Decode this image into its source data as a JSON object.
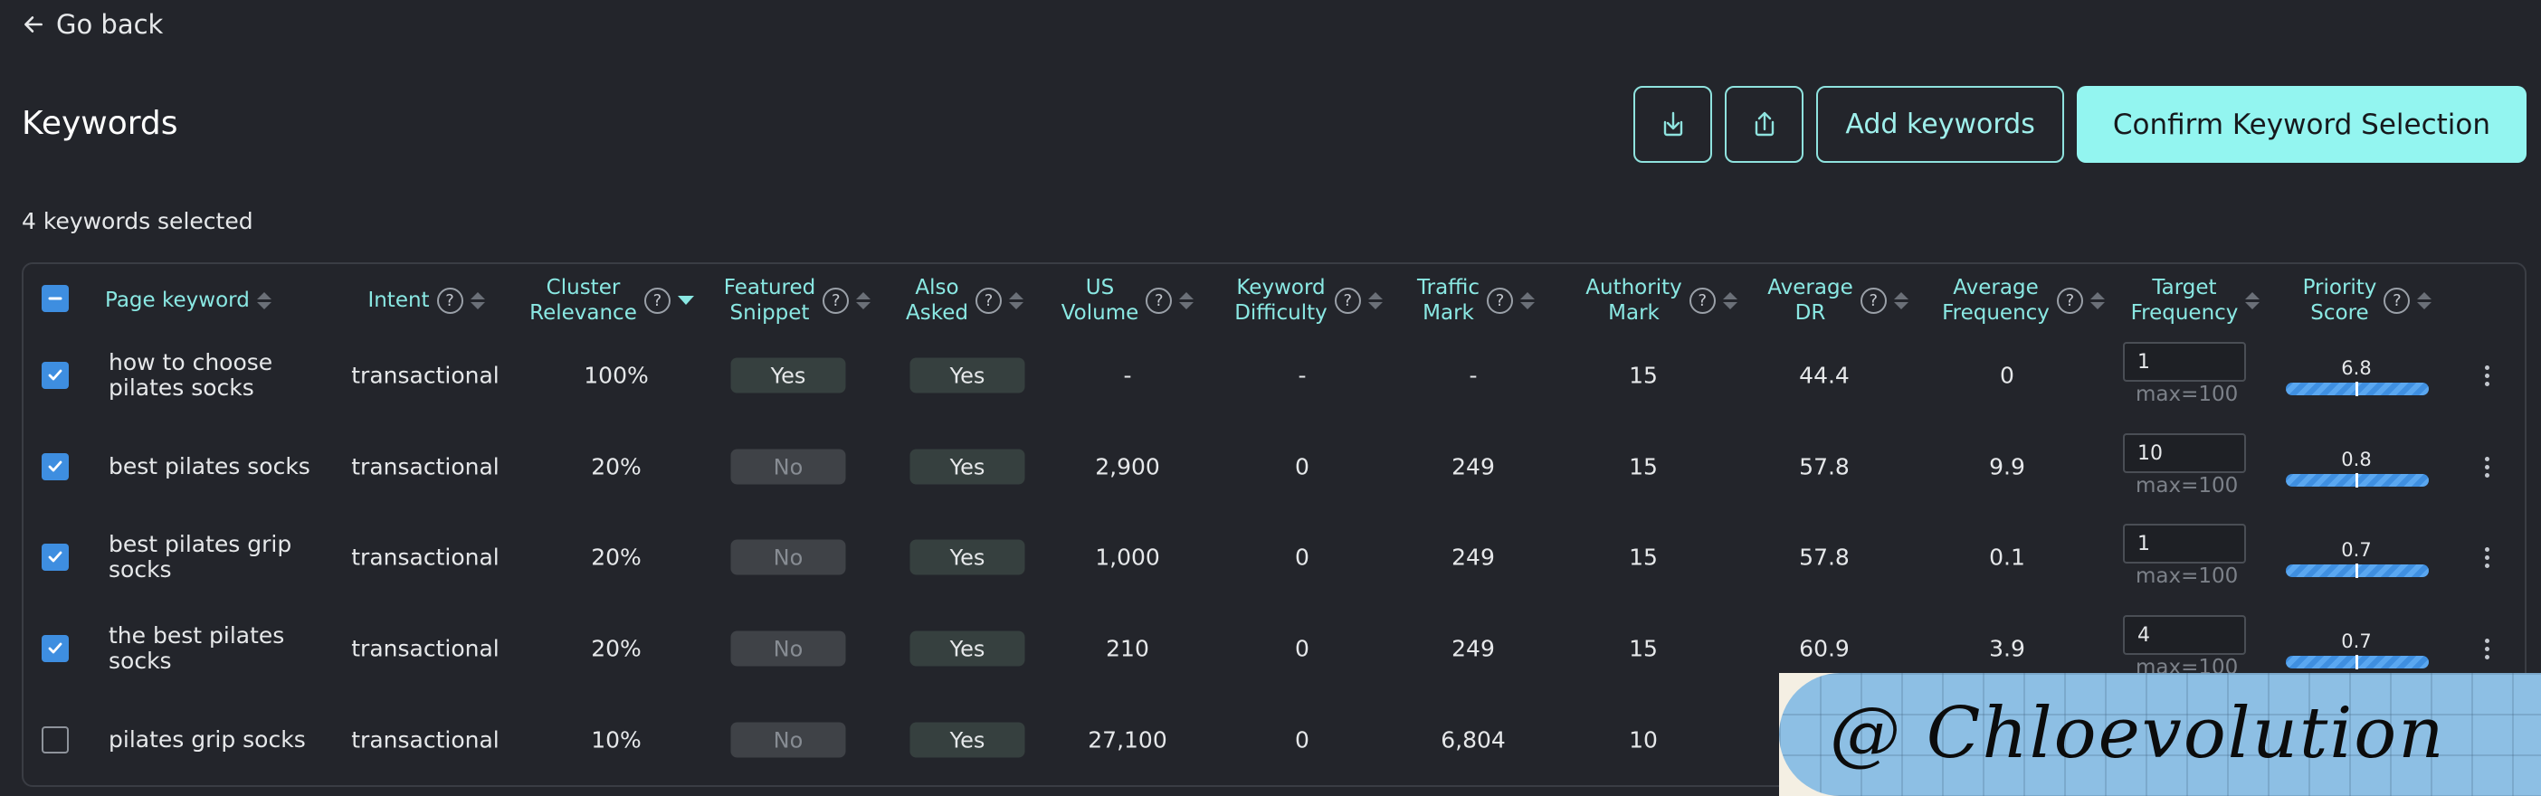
{
  "nav": {
    "go_back": "Go back"
  },
  "page": {
    "title": "Keywords",
    "selected_text": "4 keywords selected"
  },
  "toolbar": {
    "add_keywords": "Add keywords",
    "confirm": "Confirm Keyword Selection"
  },
  "columns": {
    "page_keyword": "Page keyword",
    "intent": "Intent",
    "cluster_relevance": [
      "Cluster",
      "Relevance"
    ],
    "featured_snippet": [
      "Featured",
      "Snippet"
    ],
    "also_asked": [
      "Also",
      "Asked"
    ],
    "us_volume": [
      "US",
      "Volume"
    ],
    "keyword_difficulty": [
      "Keyword",
      "Difficulty"
    ],
    "traffic_mark": [
      "Traffic",
      "Mark"
    ],
    "authority_mark": [
      "Authority",
      "Mark"
    ],
    "average_dr": [
      "Average",
      "DR"
    ],
    "average_frequency": [
      "Average",
      "Frequency"
    ],
    "target_frequency": [
      "Target",
      "Frequency"
    ],
    "priority_score": [
      "Priority",
      "Score"
    ]
  },
  "help_glyph": "?",
  "rows": [
    {
      "keyword": "how to choose pilates socks",
      "checked": true,
      "intent": "transactional",
      "relevance": "100%",
      "featured": "Yes",
      "also_asked": "Yes",
      "volume": "-",
      "difficulty": "-",
      "traffic": "-",
      "authority": "15",
      "avg_dr": "44.4",
      "avg_freq": "0",
      "target_freq": "1",
      "max": "max=100",
      "priority": "6.8"
    },
    {
      "keyword": "best pilates socks",
      "checked": true,
      "intent": "transactional",
      "relevance": "20%",
      "featured": "No",
      "also_asked": "Yes",
      "volume": "2,900",
      "difficulty": "0",
      "traffic": "249",
      "authority": "15",
      "avg_dr": "57.8",
      "avg_freq": "9.9",
      "target_freq": "10",
      "max": "max=100",
      "priority": "0.8"
    },
    {
      "keyword": "best pilates grip socks",
      "checked": true,
      "intent": "transactional",
      "relevance": "20%",
      "featured": "No",
      "also_asked": "Yes",
      "volume": "1,000",
      "difficulty": "0",
      "traffic": "249",
      "authority": "15",
      "avg_dr": "57.8",
      "avg_freq": "0.1",
      "target_freq": "1",
      "max": "max=100",
      "priority": "0.7"
    },
    {
      "keyword": "the best pilates socks",
      "checked": true,
      "intent": "transactional",
      "relevance": "20%",
      "featured": "No",
      "also_asked": "Yes",
      "volume": "210",
      "difficulty": "0",
      "traffic": "249",
      "authority": "15",
      "avg_dr": "60.9",
      "avg_freq": "3.9",
      "target_freq": "4",
      "max": "max=100",
      "priority": "0.7"
    },
    {
      "keyword": "pilates grip socks",
      "checked": false,
      "intent": "transactional",
      "relevance": "10%",
      "featured": "No",
      "also_asked": "Yes",
      "volume": "27,100",
      "difficulty": "0",
      "traffic": "6,804",
      "authority": "10"
    }
  ],
  "watermark": {
    "text": "@ Chloevolution"
  },
  "colors": {
    "accent": "#93f5f0",
    "checkbox": "#3e8ee0",
    "background": "#23252b"
  }
}
